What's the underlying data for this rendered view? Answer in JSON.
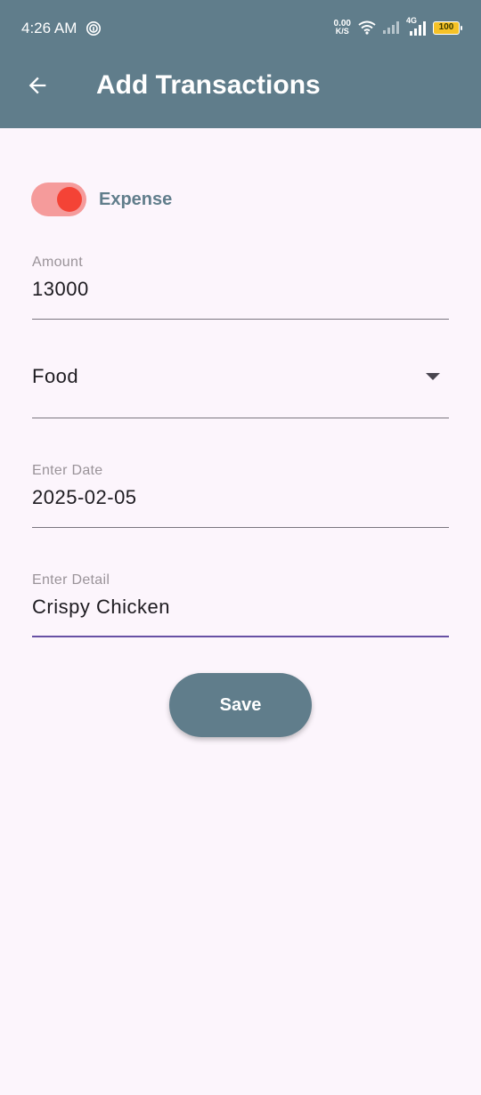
{
  "status": {
    "time": "4:26 AM",
    "net_speed_value": "0.00",
    "net_speed_unit": "K/S",
    "network_type": "4G",
    "battery": "100"
  },
  "appbar": {
    "title": "Add Transactions",
    "back_icon": "arrow-back-icon",
    "background": "#607d8b"
  },
  "form": {
    "type_toggle": {
      "label": "Expense",
      "checked": true,
      "track_color": "#f59b9b",
      "thumb_color": "#f44336"
    },
    "amount": {
      "label": "Amount",
      "value": "13000"
    },
    "category": {
      "selected": "Food"
    },
    "date": {
      "label": "Enter Date",
      "value": "2025-02-05"
    },
    "detail": {
      "label": "Enter Detail",
      "value": "Crispy Chicken",
      "focused": true,
      "focus_color": "#6750a4"
    },
    "save_label": "Save"
  }
}
